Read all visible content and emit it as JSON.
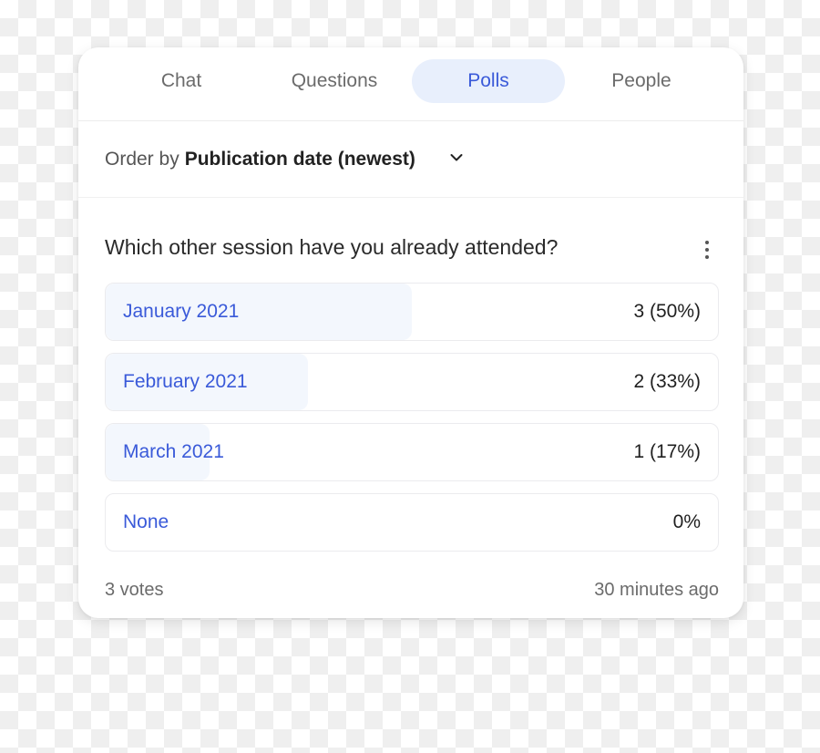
{
  "tabs": [
    {
      "label": "Chat",
      "active": false
    },
    {
      "label": "Questions",
      "active": false
    },
    {
      "label": "Polls",
      "active": true
    },
    {
      "label": "People",
      "active": false
    }
  ],
  "order": {
    "prefix": "Order by",
    "value": "Publication date (newest)",
    "icon": "chevron-down-icon"
  },
  "poll": {
    "question": "Which other session have you already attended?",
    "menu_icon": "kebab-menu-icon",
    "options": [
      {
        "label": "January 2021",
        "result": "3 (50%)",
        "votes": 3,
        "percent": 50
      },
      {
        "label": "February 2021",
        "result": "2 (33%)",
        "votes": 2,
        "percent": 33
      },
      {
        "label": "March 2021",
        "result": "1 (17%)",
        "votes": 1,
        "percent": 17
      },
      {
        "label": "None",
        "result": "0%",
        "votes": 0,
        "percent": 0
      }
    ],
    "total_votes": "3 votes",
    "time_ago": "30 minutes ago"
  },
  "colors": {
    "accent": "#3a5ad9",
    "active_tab_bg": "#e8effc",
    "option_fill": "#f3f7fd"
  }
}
